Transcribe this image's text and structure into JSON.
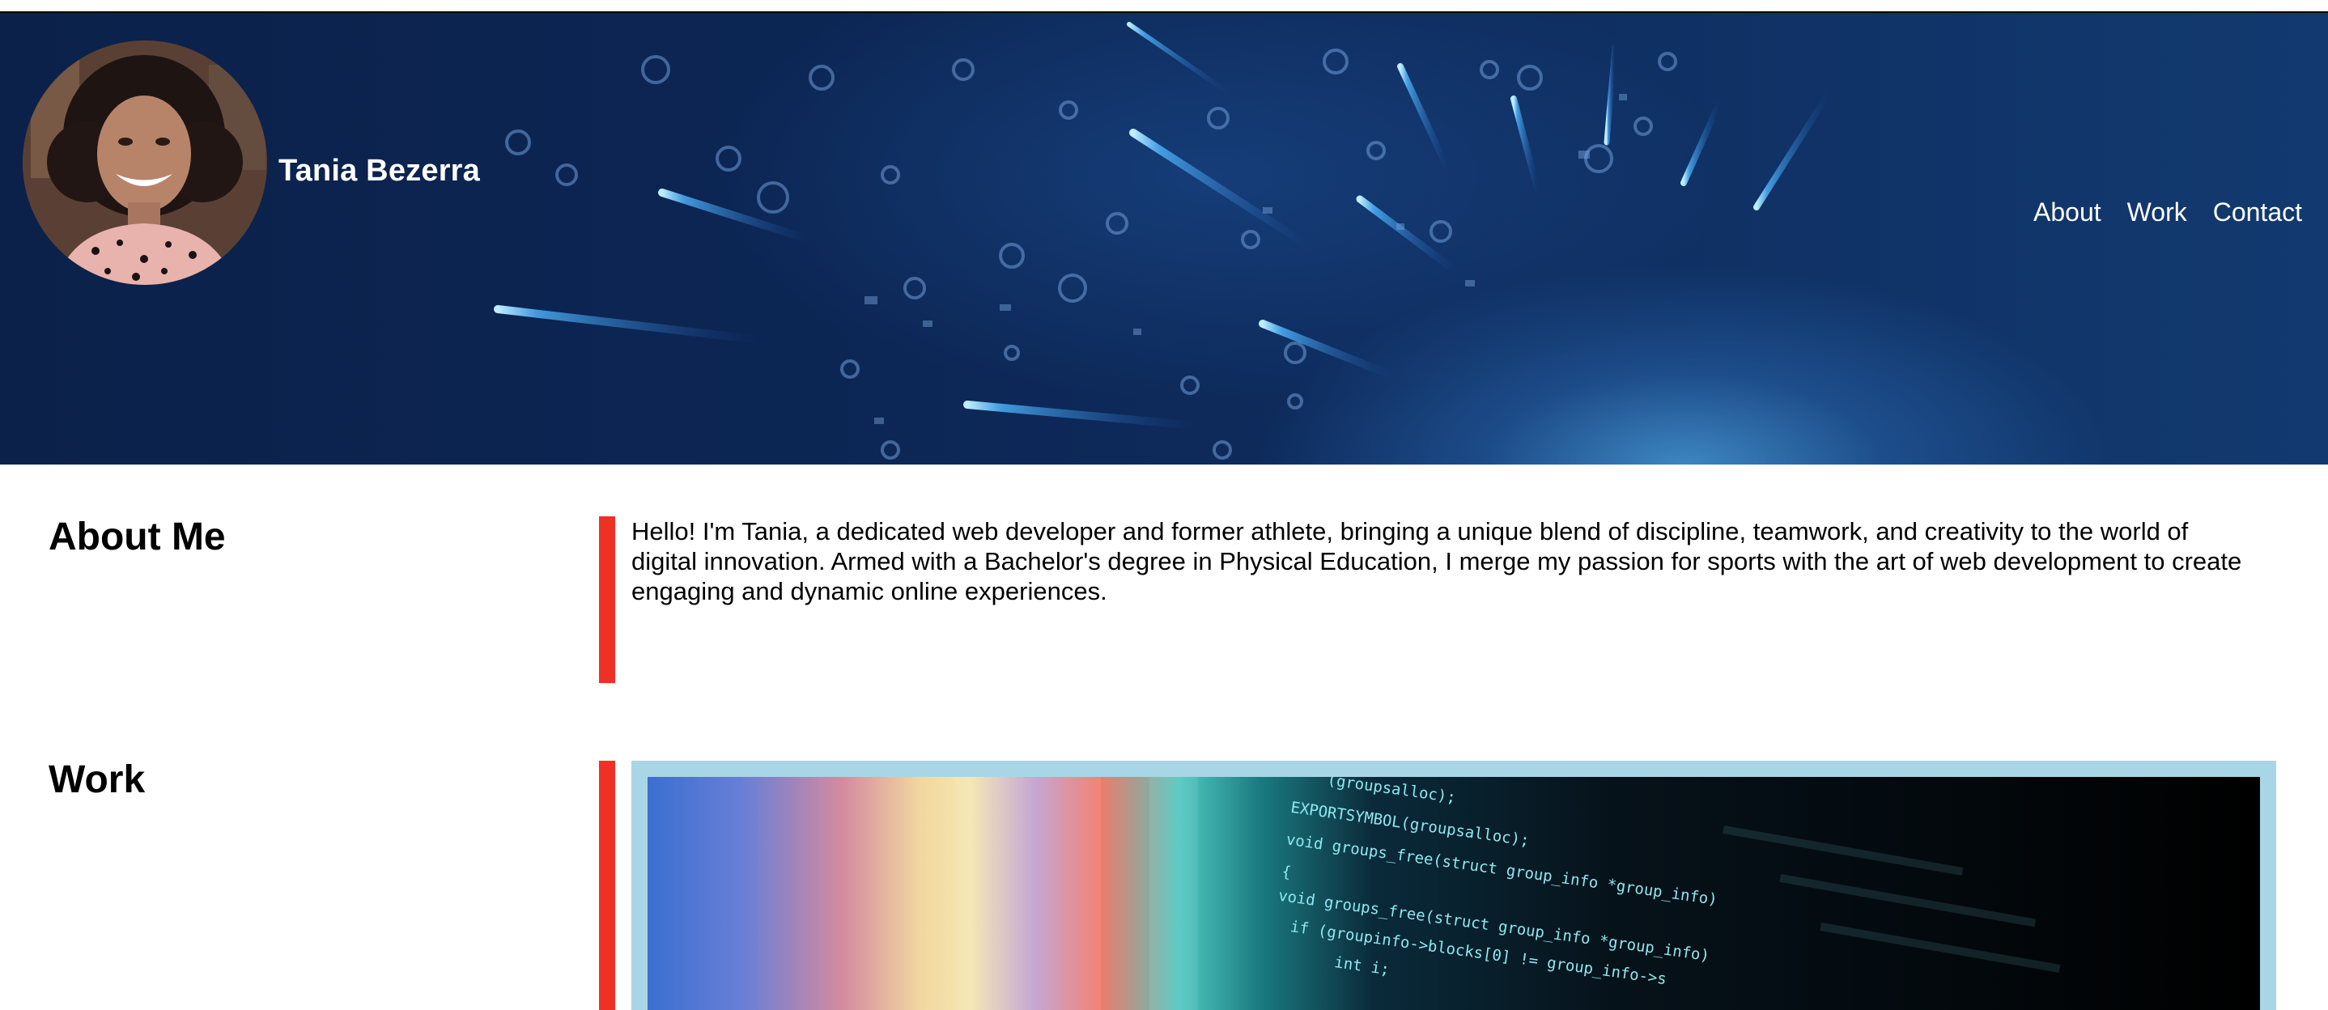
{
  "site": {
    "name": "Tania Bezerra"
  },
  "nav": {
    "items": [
      "About",
      "Work",
      "Contact"
    ]
  },
  "about": {
    "heading": "About Me",
    "text": "Hello! I'm Tania, a dedicated web developer and former athlete, bringing a unique blend of discipline, teamwork, and creativity to the world of digital innovation. Armed with a Bachelor's degree in Physical Education, I merge my passion for sports with the art of web development to create engaging and dynamic online experiences."
  },
  "work": {
    "heading": "Work",
    "code_lines": [
      "(groupsalloc);",
      "EXPORTSYMBOL(groupsalloc);",
      "void groups_free(struct group_info *group_info)",
      "{",
      "void groups_free(struct group_info *group_info)",
      "    if (groupinfo->blocks[0] != group_info->s",
      "        int i;"
    ]
  },
  "colors": {
    "accent_red": "#ee3124",
    "frame_blue": "#a9d6e6",
    "hero_navy": "#0c2654"
  }
}
